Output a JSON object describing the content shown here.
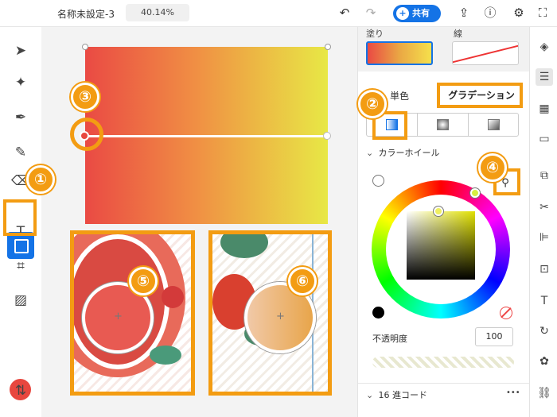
{
  "topbar": {
    "doc_title": "名称未設定-3",
    "zoom": "40.14%",
    "share_label": "共有"
  },
  "panel": {
    "fill_label": "塗り",
    "stroke_label": "線",
    "tab_solid": "単色",
    "tab_gradient": "グラデーション",
    "color_wheel_section": "カラーホイール",
    "opacity_label": "不透明度",
    "opacity_value": "100",
    "hex_section": "16 進コード",
    "more": "•••"
  },
  "callouts": [
    "①",
    "②",
    "③",
    "④",
    "⑤",
    "⑥"
  ],
  "colors": {
    "accent": "#1473e6",
    "callout": "#f39c12",
    "fill_red": "#e8473f",
    "gradient_start": "#ea4a44",
    "gradient_end": "#e8e845"
  }
}
